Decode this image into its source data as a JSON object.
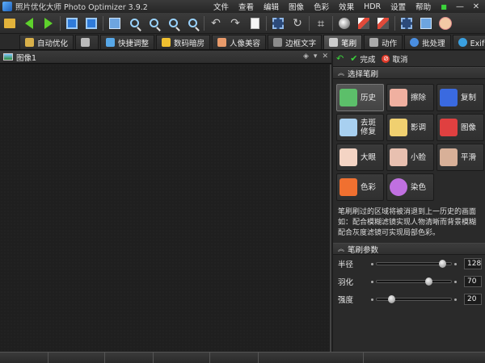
{
  "window": {
    "title": "照片优化大师 Photo Optimizer 3.9.2",
    "menu": [
      "文件",
      "查看",
      "编辑",
      "图像",
      "色彩",
      "效果",
      "HDR",
      "设置",
      "帮助"
    ],
    "controls": {
      "minimize": "—",
      "close": "✕",
      "indicator": "■"
    }
  },
  "tabs": [
    {
      "label": "自动优化",
      "icon_color": "#d8b04a"
    },
    {
      "label": "",
      "icon_color": "#bbbbbb"
    },
    {
      "label": "快捷调整",
      "icon_color": "#58a8e8"
    },
    {
      "label": "数码暗房",
      "icon_color": "#f0c030"
    },
    {
      "label": "人像美容",
      "icon_color": "#e89a6a"
    },
    {
      "label": "边框文字",
      "icon_color": "#8c8c8c"
    },
    {
      "label": "笔刷",
      "icon_color": "#cccccc",
      "active": true
    },
    {
      "label": "动作",
      "icon_color": "#aaaaaa"
    },
    {
      "label": "批处理",
      "icon_color": "#4a8ee0"
    },
    {
      "label": "Exif信息",
      "icon_color": "#3aa0e0"
    }
  ],
  "document": {
    "title": "图像1"
  },
  "panel": {
    "done_label": "完成",
    "cancel_label": "取消",
    "brush_section_title": "选择笔刷",
    "brushes": [
      {
        "label": "历史",
        "icon_color": "#5cbf6a",
        "active": true
      },
      {
        "label": "擦除",
        "icon_color": "#f0b0a0"
      },
      {
        "label": "复制",
        "icon_color": "#3a6ae0"
      },
      {
        "label": "去斑\n修复",
        "icon_color": "#a8d0f0"
      },
      {
        "label": "影调",
        "icon_color": "#f0d070"
      },
      {
        "label": "图像",
        "icon_color": "#e04040"
      },
      {
        "label": "大眼",
        "icon_color": "#f4d4c4"
      },
      {
        "label": "小脸",
        "icon_color": "#e8c0b0"
      },
      {
        "label": "平滑",
        "icon_color": "#d8b098"
      },
      {
        "label": "色彩",
        "icon_color": "#f07030"
      },
      {
        "label": "染色",
        "icon_color": "#c070e0"
      }
    ],
    "description": "笔刷刷过的区域将被消退到上一历史的画面如：配合模糊滤镜实现人物清晰而背景模糊配合灰度滤镜可实现局部色彩。",
    "params_section_title": "笔刷参数",
    "params": [
      {
        "label": "半径",
        "value": "128",
        "fraction": 0.88
      },
      {
        "label": "羽化",
        "value": "70",
        "fraction": 0.7
      },
      {
        "label": "强度",
        "value": "20",
        "fraction": 0.2
      }
    ]
  }
}
